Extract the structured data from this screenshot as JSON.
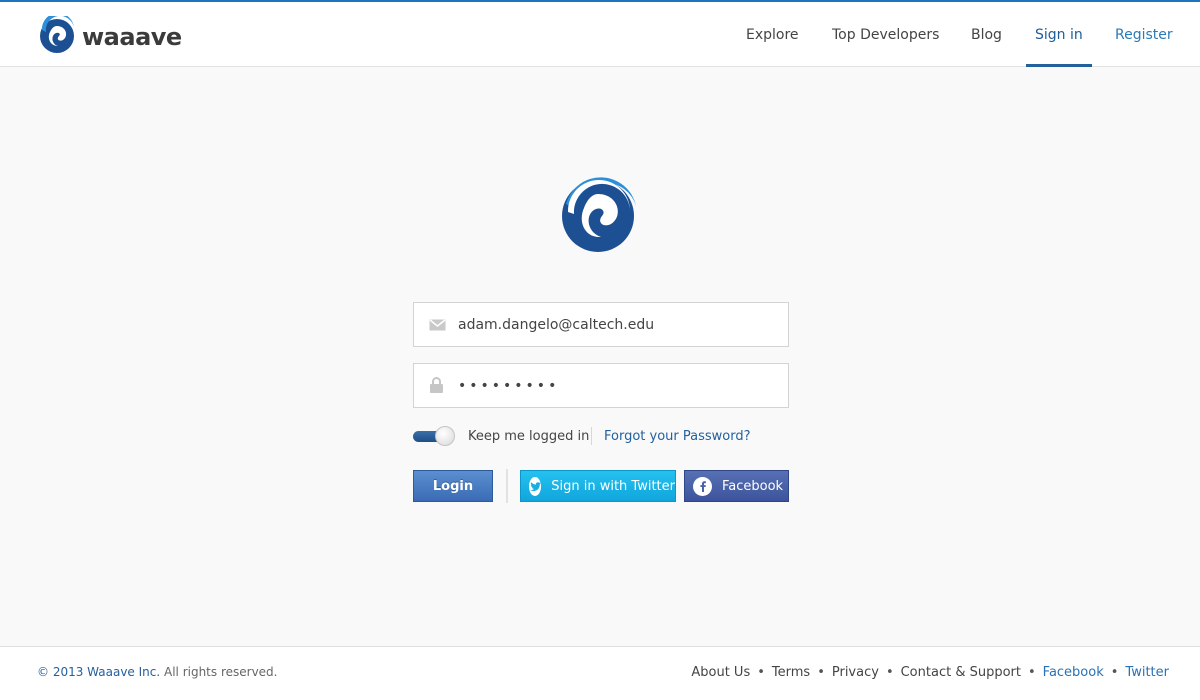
{
  "header": {
    "brand": "waaave",
    "nav": [
      {
        "label": "Explore"
      },
      {
        "label": "Top Developers"
      },
      {
        "label": "Blog"
      },
      {
        "label": "Sign in"
      },
      {
        "label": "Register"
      }
    ],
    "active_nav": "Sign in"
  },
  "login_form": {
    "email_value": "adam.dangelo@caltech.edu",
    "password_value": "•••••••••",
    "keep_logged_in_label": "Keep me logged in",
    "keep_logged_in_checked": true,
    "forgot_password_label": "Forgot your Password?",
    "login_button_label": "Login",
    "twitter_button_label": "Sign in with Twitter",
    "facebook_button_label": "Facebook"
  },
  "footer": {
    "copyright_owner": "© 2013 Waaave Inc.",
    "copyright_suffix": " All rights reserved.",
    "links": [
      {
        "label": "About Us"
      },
      {
        "label": "Terms"
      },
      {
        "label": "Privacy"
      },
      {
        "label": "Contact & Support"
      },
      {
        "label": "Facebook"
      },
      {
        "label": "Twitter"
      }
    ]
  },
  "icons": {
    "brand_logo": "wave-logo-icon",
    "email": "envelope-icon",
    "password": "lock-icon",
    "twitter": "twitter-bird-icon",
    "facebook": "facebook-f-icon"
  },
  "colors": {
    "accent": "#1e73be",
    "link": "#23609f",
    "twitter": "#17b2e6",
    "facebook": "#4a62a8"
  }
}
